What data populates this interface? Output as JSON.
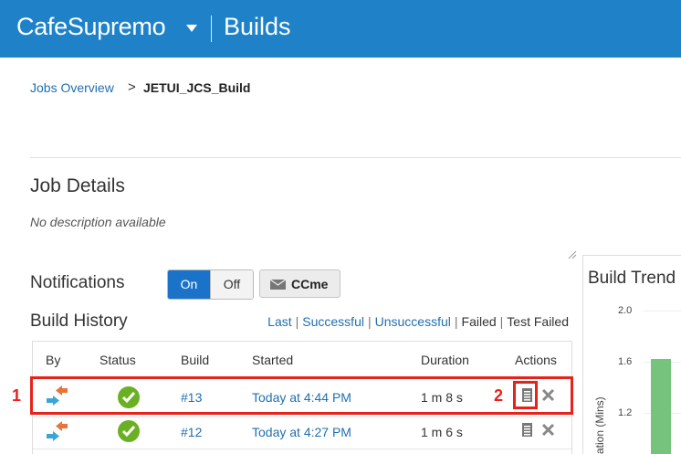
{
  "header": {
    "app_name": "CafeSupremo",
    "page_name": "Builds",
    "bg_color": "#1f82c9"
  },
  "breadcrumb": {
    "parent": "Jobs Overview",
    "separator": ">",
    "current": "JETUI_JCS_Build"
  },
  "job_details": {
    "title": "Job Details",
    "description": "No description available"
  },
  "notifications": {
    "label": "Notifications",
    "on": "On",
    "off": "Off",
    "selected": "On",
    "ccme": "CCme"
  },
  "build_history": {
    "title": "Build History",
    "filters": [
      "Last",
      "Successful",
      "Unsuccessful",
      "Failed",
      "Test Failed"
    ],
    "columns": [
      "By",
      "Status",
      "Build",
      "Started",
      "Duration",
      "Actions"
    ],
    "rows": [
      {
        "by_icon": "commit-trigger-icon",
        "status": "success",
        "build": "#13",
        "started": "Today at 4:44 PM",
        "duration": "1 m 8 s"
      },
      {
        "by_icon": "commit-trigger-icon",
        "status": "success",
        "build": "#12",
        "started": "Today at 4:27 PM",
        "duration": "1 m 6 s"
      }
    ]
  },
  "annotations": {
    "marker1": "1",
    "marker2": "2",
    "color": "#e5231b"
  },
  "build_trend": {
    "title": "Build Trend",
    "y_axis_label": "ation (Mins)",
    "y_ticks": [
      "2.0",
      "1.6",
      "1.2"
    ]
  }
}
